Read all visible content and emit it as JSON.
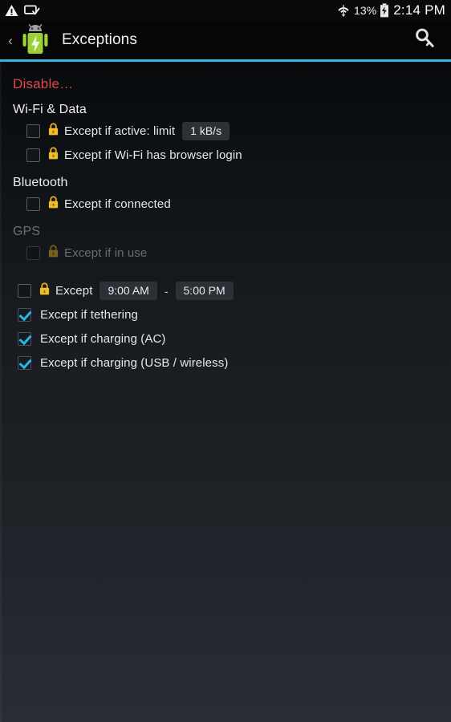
{
  "status_bar": {
    "icons_left": [
      "warning-triangle-icon",
      "cast-screen-check-icon"
    ],
    "wifi_icon": "wifi-icon",
    "battery_percent": "13%",
    "battery_icon": "battery-charging-icon",
    "clock": "2:14 PM"
  },
  "action_bar": {
    "back_label": "‹",
    "app_icon": "android-battery-icon",
    "title": "Exceptions",
    "key_icon": "key-icon",
    "accent_color": "#33b5e5"
  },
  "content": {
    "disable_label": "Disable…",
    "disable_color": "#e2474f",
    "sections": [
      {
        "header": "Wi-Fi & Data",
        "enabled": true,
        "rows": [
          {
            "checked": false,
            "locked": true,
            "label": "Except if active: limit",
            "pill": "1 kB/s"
          },
          {
            "checked": false,
            "locked": true,
            "label": "Except if Wi-Fi has browser login"
          }
        ]
      },
      {
        "header": "Bluetooth",
        "enabled": true,
        "rows": [
          {
            "checked": false,
            "locked": true,
            "label": "Except if connected"
          }
        ]
      },
      {
        "header": "GPS",
        "enabled": false,
        "rows": [
          {
            "checked": false,
            "locked": true,
            "label": "Except if in use"
          }
        ]
      }
    ],
    "time_row": {
      "checked": false,
      "locked": true,
      "label": "Except",
      "time_from": "9:00 AM",
      "separator": "-",
      "time_to": "5:00 PM"
    },
    "bottom_rows": [
      {
        "checked": true,
        "locked": false,
        "label": "Except if tethering"
      },
      {
        "checked": true,
        "locked": false,
        "label": "Except if charging (AC)"
      },
      {
        "checked": true,
        "locked": false,
        "label": "Except if charging (USB / wireless)"
      }
    ]
  }
}
